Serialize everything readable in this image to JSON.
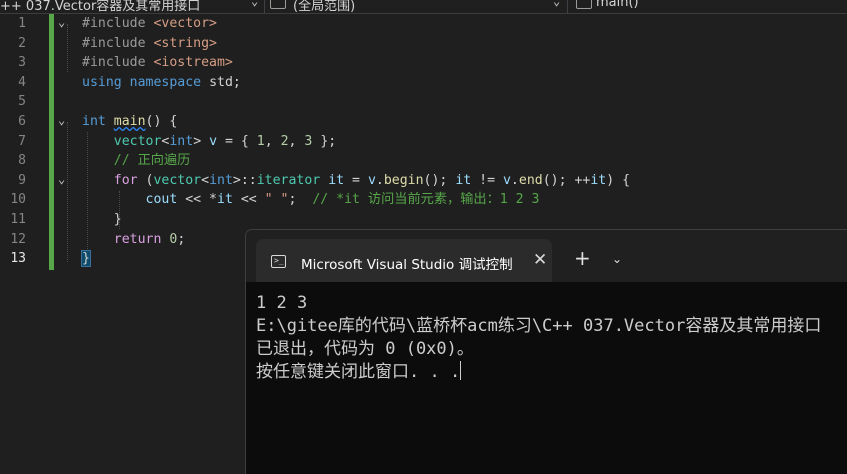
{
  "navbar": {
    "project_dropdown": "++ 037.Vector容器及其常用接口",
    "scope_dropdown": "(全局范围)",
    "member_dropdown": "main()"
  },
  "editor": {
    "line_numbers": [
      "1",
      "2",
      "3",
      "4",
      "5",
      "6",
      "7",
      "8",
      "9",
      "10",
      "11",
      "12",
      "13"
    ],
    "current_line": "13",
    "code": {
      "l1_pp": "#include",
      "l1_inc": " <vector>",
      "l2_pp": "#include",
      "l2_inc": " <string>",
      "l3_pp": "#include",
      "l3_inc": " <iostream>",
      "l4_kw1": "using",
      "l4_kw2": "namespace",
      "l4_rest": " std;",
      "l6_int": "int",
      "l6_main": "main",
      "l6_rest": "() {",
      "l7_vector": "vector",
      "l7_lt": "<",
      "l7_int": "int",
      "l7_rest1": "> ",
      "l7_v": "v",
      "l7_rest2": " = { ",
      "l7_n1": "1",
      "l7_c1": ", ",
      "l7_n2": "2",
      "l7_c2": ", ",
      "l7_n3": "3",
      "l7_rest3": " };",
      "l8_comment": "// 正向遍历",
      "l9_for": "for",
      "l9_p1": " (",
      "l9_vector": "vector",
      "l9_lt": "<",
      "l9_int": "int",
      "l9_gt": ">::",
      "l9_iter": "iterator",
      "l9_sp": " ",
      "l9_it": "it",
      "l9_eq": " = ",
      "l9_v": "v",
      "l9_dot": ".",
      "l9_begin": "begin",
      "l9_p2": "(); ",
      "l9_it2": "it",
      "l9_ne": " != ",
      "l9_v2": "v",
      "l9_dot2": ".",
      "l9_end": "end",
      "l9_p3": "(); ++",
      "l9_it3": "it",
      "l9_p4": ") {",
      "l10_cout": "cout",
      "l10_op1": " << *",
      "l10_it": "it",
      "l10_op2": " << ",
      "l10_str": "\" \"",
      "l10_semi": ";  ",
      "l10_comment": "// *it 访问当前元素，输出：1 2 3",
      "l11_brace": "}",
      "l12_return": "return",
      "l12_sp": " ",
      "l12_zero": "0",
      "l12_semi": ";",
      "l13_brace": "}"
    }
  },
  "console": {
    "tab_title": "Microsoft Visual Studio 调试控制台",
    "prompt_glyph": ">_",
    "close_glyph": "✕",
    "new_tab_glyph": "+",
    "dropdown_glyph": "⌄",
    "lines": [
      "1 2 3",
      "E:\\gitee库的代码\\蓝桥杯acm练习\\C++ 037.Vector容器及其常用接口",
      "已退出，代码为 0 (0x0)。",
      "按任意键关闭此窗口. . ."
    ]
  },
  "colors": {
    "background": "#1f1f1f",
    "keyword": "#569cd6",
    "type": "#4ec9b0",
    "function": "#dcdcaa",
    "comment": "#57a64a",
    "string": "#d69d85",
    "number": "#b5cea8",
    "control": "#d8a0df",
    "change_bar": "#57a64a",
    "console_bg": "#0c0c0c"
  }
}
